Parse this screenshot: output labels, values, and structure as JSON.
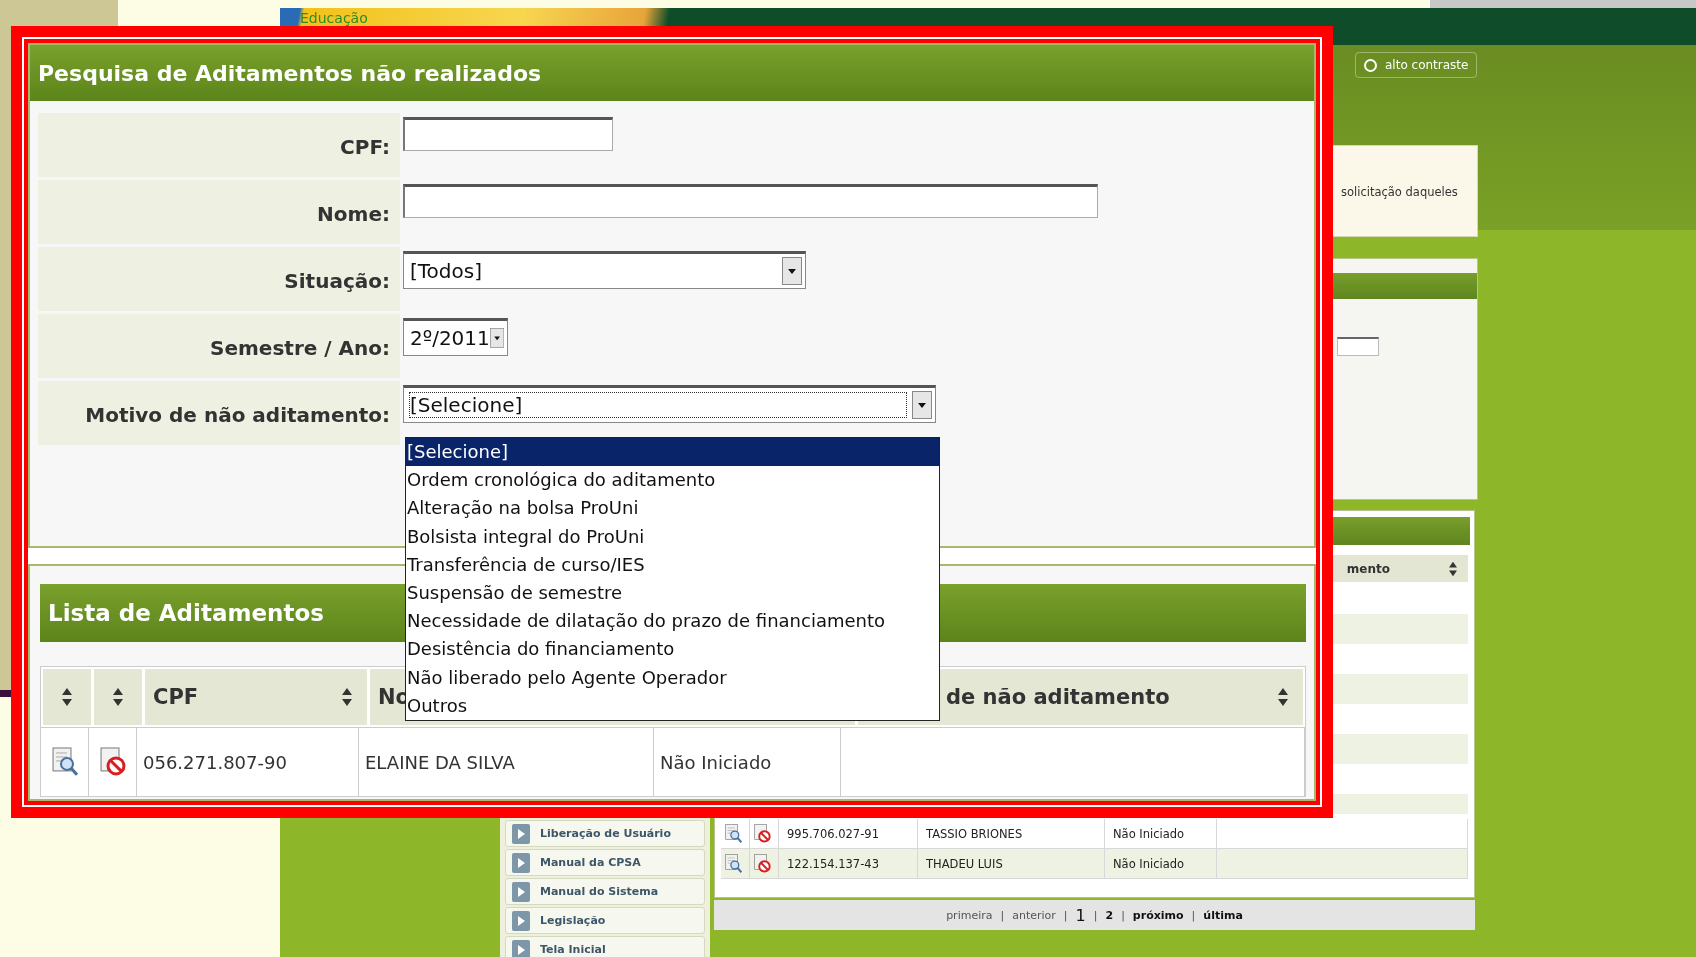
{
  "background_page": {
    "logo_text": "Educação",
    "contrast_option": {
      "label": "alto contraste",
      "selected": false
    },
    "notice_text": "solicitação daqueles",
    "column_header": "mento",
    "sidebar": {
      "items": [
        {
          "label": "Liberação de Usuário"
        },
        {
          "label": "Manual da CPSA"
        },
        {
          "label": "Manual do Sistema"
        },
        {
          "label": "Legislação"
        },
        {
          "label": "Tela Inicial"
        }
      ]
    },
    "rows": [
      {
        "cpf": "995.706.027-91",
        "nome": "TASSIO BRIONES",
        "situacao": "Não Iniciado"
      },
      {
        "cpf": "122.154.137-43",
        "nome": "THADEU LUIS",
        "situacao": "Não Iniciado"
      }
    ],
    "pagination": [
      {
        "kind": "link",
        "label": "primeira",
        "disabled": true,
        "current": false
      },
      {
        "kind": "separator",
        "label": "|"
      },
      {
        "kind": "link",
        "label": "anterior",
        "disabled": true,
        "current": false
      },
      {
        "kind": "separator",
        "label": "|"
      },
      {
        "kind": "link",
        "label": "1",
        "disabled": false,
        "current": true
      },
      {
        "kind": "separator",
        "label": "|"
      },
      {
        "kind": "link",
        "label": "2",
        "disabled": false,
        "current": false
      },
      {
        "kind": "separator",
        "label": "|"
      },
      {
        "kind": "link",
        "label": "próximo",
        "disabled": false,
        "current": false
      },
      {
        "kind": "separator",
        "label": "|"
      },
      {
        "kind": "link",
        "label": "última",
        "disabled": false,
        "current": false
      }
    ]
  },
  "zoomed_form": {
    "title": "Pesquisa de Aditamentos não realizados",
    "fields": [
      {
        "label": "CPF:",
        "kind": "text",
        "focused": false
      },
      {
        "label": "Nome:",
        "kind": "text",
        "focused": false
      },
      {
        "label": "Situação:",
        "kind": "select",
        "value": "[Todos]",
        "focused": false
      },
      {
        "label": "Semestre / Ano:",
        "kind": "select",
        "value": "2º/2011",
        "focused": false
      },
      {
        "label": "Motivo de não aditamento:",
        "kind": "select",
        "value": "[Selecione]",
        "focused": true
      }
    ],
    "dropdown": {
      "options": [
        {
          "label": "[Selecione]",
          "selected": true
        },
        {
          "label": "Ordem cronológica do aditamento",
          "selected": false
        },
        {
          "label": "Alteração na bolsa ProUni",
          "selected": false
        },
        {
          "label": "Bolsista integral do ProUni",
          "selected": false
        },
        {
          "label": "Transferência de curso/IES",
          "selected": false
        },
        {
          "label": "Suspensão de semestre",
          "selected": false
        },
        {
          "label": "Necessidade de dilatação do prazo de financiamento",
          "selected": false
        },
        {
          "label": "Desistência do financiamento",
          "selected": false
        },
        {
          "label": "Não liberado pelo Agente Operador",
          "selected": false
        },
        {
          "label": "Outros",
          "selected": false
        }
      ]
    },
    "list": {
      "title": "Lista de Aditamentos",
      "columns": [
        {
          "kind": "action",
          "sortable": true
        },
        {
          "kind": "action",
          "sortable": true
        },
        {
          "kind": "text",
          "label": "CPF",
          "sortable": true
        },
        {
          "kind": "text",
          "label": "No"
        },
        {
          "kind": "text",
          "label": "de não aditamento",
          "sortable": true
        }
      ],
      "rows": [
        {
          "cpf": "056.271.807-90",
          "nome": "ELAINE DA SILVA",
          "situacao": "Não Iniciado"
        }
      ]
    }
  }
}
